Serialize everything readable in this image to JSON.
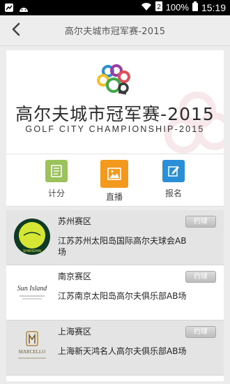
{
  "status_bar": {
    "battery_percent": "100%",
    "time": "15:19",
    "icons": [
      "notification-icon",
      "android-icon",
      "wifi-icon",
      "signal-icon",
      "battery-icon"
    ]
  },
  "header": {
    "title": "高尔夫城市冠军赛-2015",
    "back_icon": "chevron-left-icon"
  },
  "banner": {
    "title": "高尔夫城市冠军赛-2015",
    "subtitle": "GOLF CITY CHAMPIONSHIP-2015"
  },
  "functions": [
    {
      "label": "计分",
      "icon": "scorecard-icon",
      "color": "#9cc35b"
    },
    {
      "label": "直播",
      "icon": "photo-icon",
      "color": "#f39a1e"
    },
    {
      "label": "报名",
      "icon": "edit-icon",
      "color": "#2b8fd8"
    }
  ],
  "competitions": [
    {
      "region": "苏州赛区",
      "course": "江苏苏州太阳岛国际高尔夫球会AB场",
      "book_label": "约球",
      "logo_text": "SHANGHAI"
    },
    {
      "region": "南京赛区",
      "course": "江苏南京太阳岛高尔夫俱乐部AB场",
      "book_label": "约球",
      "logo_text": "Sun Island"
    },
    {
      "region": "上海赛区",
      "course": "上海新天鸿名人高尔夫俱乐部AB场",
      "book_label": "约球",
      "logo_text": "MARCELLO"
    }
  ],
  "colors": {
    "accent_green": "#9cc35b",
    "accent_orange": "#f39a1e",
    "accent_blue": "#2b8fd8"
  }
}
